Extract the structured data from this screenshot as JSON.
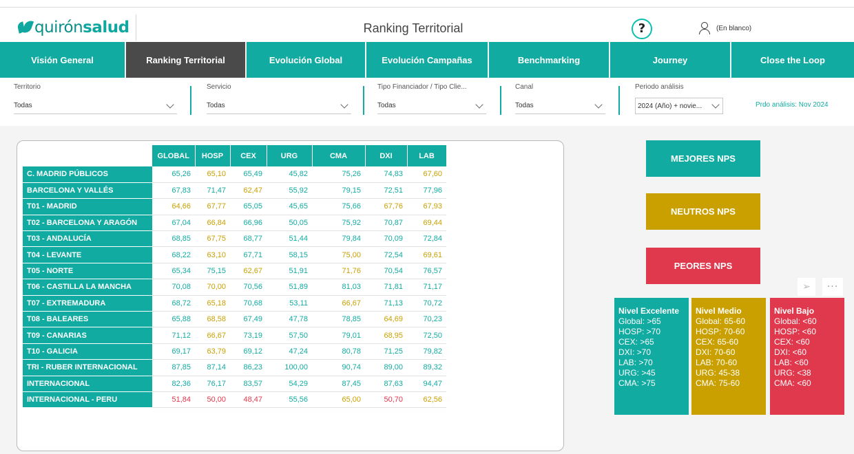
{
  "header": {
    "logo_q": "quirón",
    "logo_s": "salud",
    "title": "Ranking Territorial",
    "help": "?",
    "user": "(En blanco)"
  },
  "nav": {
    "tabs": [
      {
        "label": "Visión General"
      },
      {
        "label": "Ranking Territorial"
      },
      {
        "label": "Evolución Global"
      },
      {
        "label": "Evolución Campañas"
      },
      {
        "label": "Benchmarking"
      },
      {
        "label": "Journey"
      },
      {
        "label": "Close the Loop"
      }
    ]
  },
  "filters": {
    "territorio": {
      "label": "Territorio",
      "value": "Todas"
    },
    "servicio": {
      "label": "Servicio",
      "value": "Todas"
    },
    "tipo": {
      "label": "Tipo Financiador / Tipo Clie...",
      "value": "Todas"
    },
    "canal": {
      "label": "Canal",
      "value": "Todas"
    },
    "periodo": {
      "label": "Periodo análisis",
      "value": "2024 (Año) + novie..."
    },
    "note": "Prdo análisis: Nov 2024"
  },
  "table": {
    "columns": [
      "GLOBAL",
      "HOSP",
      "CEX",
      "URG",
      "CMA",
      "DXI",
      "LAB"
    ],
    "rows": [
      {
        "name": "C. MADRID PÚBLICOS",
        "values": [
          "65,26",
          "65,10",
          "65,49",
          "45,82",
          "75,26",
          "74,83",
          "67,60"
        ],
        "colors": [
          "g",
          "y",
          "g",
          "g",
          "g",
          "g",
          "y"
        ]
      },
      {
        "name": "BARCELONA Y VALLÉS",
        "values": [
          "67,83",
          "71,47",
          "62,47",
          "55,92",
          "79,15",
          "72,51",
          "77,96"
        ],
        "colors": [
          "g",
          "g",
          "y",
          "g",
          "g",
          "g",
          "g"
        ]
      },
      {
        "name": "T01 - MADRID",
        "values": [
          "64,66",
          "67,77",
          "65,05",
          "45,65",
          "75,66",
          "67,76",
          "67,93"
        ],
        "colors": [
          "y",
          "y",
          "g",
          "g",
          "g",
          "y",
          "y"
        ]
      },
      {
        "name": "T02 - BARCELONA Y ARAGÓN",
        "values": [
          "67,04",
          "66,84",
          "66,96",
          "50,05",
          "75,92",
          "70,87",
          "69,44"
        ],
        "colors": [
          "g",
          "y",
          "g",
          "g",
          "g",
          "g",
          "y"
        ]
      },
      {
        "name": "T03 - ANDALUCÍA",
        "values": [
          "68,85",
          "67,75",
          "68,77",
          "51,44",
          "79,84",
          "70,09",
          "72,84"
        ],
        "colors": [
          "g",
          "y",
          "g",
          "g",
          "g",
          "g",
          "g"
        ]
      },
      {
        "name": "T04 - LEVANTE",
        "values": [
          "68,22",
          "63,10",
          "67,71",
          "58,15",
          "75,00",
          "72,54",
          "69,61"
        ],
        "colors": [
          "g",
          "y",
          "g",
          "g",
          "y",
          "g",
          "y"
        ]
      },
      {
        "name": "T05 - NORTE",
        "values": [
          "65,34",
          "75,15",
          "62,67",
          "51,91",
          "71,76",
          "70,54",
          "76,57"
        ],
        "colors": [
          "g",
          "g",
          "y",
          "g",
          "y",
          "g",
          "g"
        ]
      },
      {
        "name": "T06 - CASTILLA LA MANCHA",
        "values": [
          "70,08",
          "70,00",
          "70,56",
          "51,89",
          "81,03",
          "71,81",
          "71,17"
        ],
        "colors": [
          "g",
          "y",
          "g",
          "g",
          "g",
          "g",
          "g"
        ]
      },
      {
        "name": "T07 - EXTREMADURA",
        "values": [
          "68,72",
          "65,18",
          "70,68",
          "53,11",
          "66,67",
          "71,13",
          "70,72"
        ],
        "colors": [
          "g",
          "y",
          "g",
          "g",
          "y",
          "g",
          "g"
        ]
      },
      {
        "name": "T08 - BALEARES",
        "values": [
          "65,88",
          "68,58",
          "67,49",
          "47,78",
          "78,85",
          "64,69",
          "70,23"
        ],
        "colors": [
          "g",
          "y",
          "g",
          "g",
          "g",
          "y",
          "g"
        ]
      },
      {
        "name": "T09 - CANARIAS",
        "values": [
          "71,12",
          "66,67",
          "73,19",
          "57,50",
          "79,01",
          "68,95",
          "72,50"
        ],
        "colors": [
          "g",
          "y",
          "g",
          "g",
          "g",
          "y",
          "g"
        ]
      },
      {
        "name": "T10 - GALICIA",
        "values": [
          "69,17",
          "63,79",
          "69,12",
          "47,24",
          "80,78",
          "71,25",
          "79,82"
        ],
        "colors": [
          "g",
          "y",
          "g",
          "g",
          "g",
          "g",
          "g"
        ]
      },
      {
        "name": "TRI - RUBER INTERNACIONAL",
        "values": [
          "87,85",
          "87,14",
          "86,23",
          "100,00",
          "90,74",
          "89,00",
          "89,32"
        ],
        "colors": [
          "g",
          "g",
          "g",
          "g",
          "g",
          "g",
          "g"
        ]
      },
      {
        "name": "INTERNACIONAL",
        "values": [
          "82,36",
          "76,17",
          "83,57",
          "54,29",
          "87,45",
          "87,63",
          "94,47"
        ],
        "colors": [
          "g",
          "g",
          "g",
          "g",
          "g",
          "g",
          "g"
        ]
      },
      {
        "name": "INTERNACIONAL - PERU",
        "values": [
          "51,84",
          "50,00",
          "48,47",
          "55,56",
          "65,00",
          "50,70",
          "62,56"
        ],
        "colors": [
          "r",
          "r",
          "r",
          "g",
          "y",
          "r",
          "y"
        ]
      }
    ]
  },
  "nps": {
    "best": "MEJORES NPS",
    "neutral": "NEUTROS NPS",
    "worst": "PEORES NPS"
  },
  "levels": [
    {
      "title": "Nivel Excelente",
      "lines": [
        "Global: >65",
        "HOSP: >70",
        "CEX: >65",
        "DXI: >70",
        "LAB: >70",
        "URG: >45",
        "CMA: >75"
      ]
    },
    {
      "title": "Nivel Medio",
      "lines": [
        "Global: 65-60",
        "HOSP: 70-60",
        "CEX: 65-60",
        "DXI: 70-60",
        "LAB: 70-60",
        "URG: 45-38",
        "CMA: 75-60"
      ]
    },
    {
      "title": "Nivel Bajo",
      "lines": [
        "Global: <60",
        "HOSP: <60",
        "CEX: <60",
        "DXI: <60",
        "LAB: <60",
        "URG: <38",
        "CMA: <60"
      ]
    }
  ],
  "colors": {
    "teal": "#12aba2",
    "yellow": "#c9a000",
    "red": "#e0384c",
    "dark": "#4a4a4a"
  },
  "toolbar": {
    "pin_icon": "pin-icon",
    "more_icon": "more-options-icon",
    "more_glyph": "···"
  }
}
